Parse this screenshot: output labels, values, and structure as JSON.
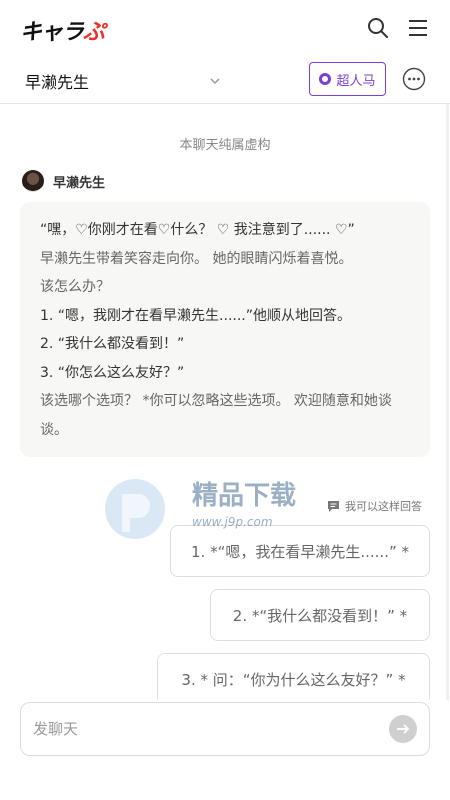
{
  "app": {
    "logo_main": "キャラ",
    "logo_accent": "ぷ"
  },
  "header": {
    "search_icon": "search-icon",
    "menu_icon": "hamburger-menu-icon"
  },
  "chat": {
    "name": "早濑先生",
    "super_button_label": "超人马",
    "more_icon": "more-horizontal-icon"
  },
  "content": {
    "disclaimer": "本聊天纯属虚构",
    "character_name": "早濑先生",
    "message_lines": [
      "“嘿，♡你刚才在看♡什么？ ♡ 我注意到了...... ♡”",
      "早濑先生带着笑容走向你。 她的眼睛闪烁着喜悦。",
      "该怎么办？",
      "1. “嗯，我刚才在看早濑先生......”他顺从地回答。",
      "2. “我什么都没看到！”",
      "3. “你怎么这么友好？”",
      "该选哪个选项？ *你可以忽略这些选项。 欢迎随意和她谈谈。"
    ],
    "reply_hint": "我可以这样回答",
    "options": [
      "1. *“嗯，我在看早濑先生......” *",
      "2. *“我什么都没看到！” *",
      "3. * 问：“你为什么这么友好？” *"
    ]
  },
  "watermark": {
    "title": "精品下载",
    "url": "www.j9p.com"
  },
  "input": {
    "placeholder": "发聊天",
    "value": ""
  },
  "colors": {
    "accent": "#7b3fd6",
    "logo_accent": "#e8332a"
  }
}
